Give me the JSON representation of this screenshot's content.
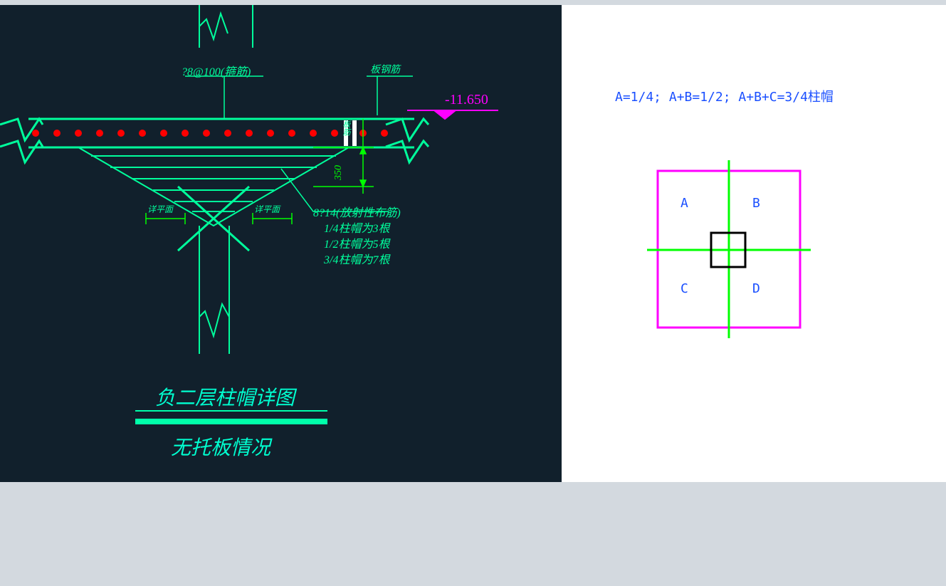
{
  "cad": {
    "rebar_spec": "?8@100(箍筋)",
    "slab_rebar_label": "板钢筋",
    "level": "-11.650",
    "dim_350": "350",
    "see_plan_left": "详平面",
    "see_plan_right": "详平面",
    "note_main": "8?14(放射性布筋)",
    "note_1": "1/4柱帽为3根",
    "note_2": "1/2柱帽为5根",
    "note_3": "3/4柱帽为7根",
    "slab_label": "板筋",
    "title_main": "负二层柱帽详图",
    "title_sub": "无托板情况"
  },
  "right": {
    "formula": "A=1/4;   A+B=1/2; A+B+C=3/4柱帽",
    "quad": {
      "A": "A",
      "B": "B",
      "C": "C",
      "D": "D"
    }
  },
  "colors": {
    "slab_line": "#00ff9c",
    "rebar_dot": "#ff0000",
    "dim": "#00ff00",
    "magenta": "#ff00ff",
    "blue": "#1a4fff"
  }
}
